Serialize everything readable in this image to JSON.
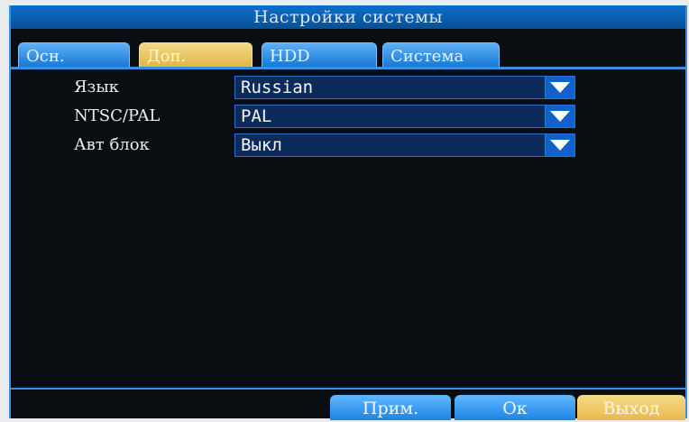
{
  "header": {
    "title": "Настройки системы"
  },
  "tabs": [
    {
      "label": "Осн.",
      "active": false
    },
    {
      "label": "Доп.",
      "active": true
    },
    {
      "label": "HDD",
      "active": false
    },
    {
      "label": "Система",
      "active": false
    }
  ],
  "settings": [
    {
      "label": "Язык",
      "value": "Russian"
    },
    {
      "label": "NTSC/PAL",
      "value": "PAL"
    },
    {
      "label": "Авт блок",
      "value": "Выкл"
    }
  ],
  "footer": {
    "apply_label": "Прим.",
    "ok_label": "Ок",
    "exit_label": "Выход"
  },
  "colors": {
    "accent_blue": "#1778d6",
    "active_gold": "#e2b644",
    "background": "#0a0d12"
  },
  "icons": {
    "dropdown": "chevron-down-icon"
  }
}
